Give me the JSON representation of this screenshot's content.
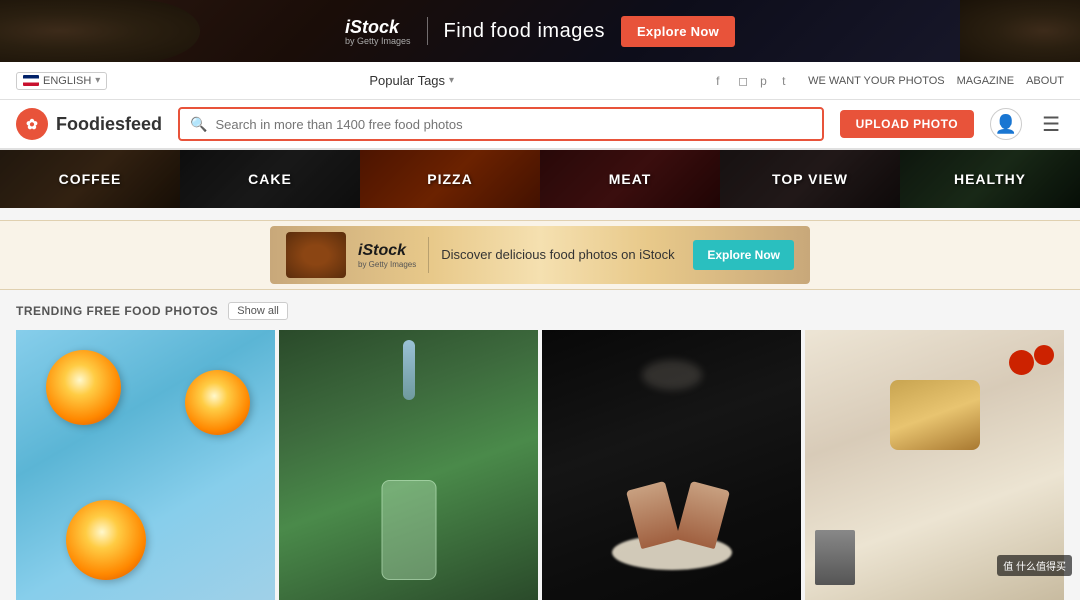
{
  "topBanner": {
    "istock": "iStock",
    "byGetty": "by Getty Images",
    "tagline": "Find food images",
    "ctaLabel": "Explore Now"
  },
  "navBar": {
    "language": "ENGLISH",
    "popularTags": "Popular Tags",
    "socialLinks": [
      "f",
      "ig",
      "p",
      "tw"
    ],
    "links": [
      "WE WANT YOUR PHOTOS",
      "MAGAZINE",
      "ABOUT"
    ]
  },
  "header": {
    "logoText": "Foodiesfeed",
    "searchPlaceholder": "Search in more than 1400 free food photos",
    "uploadLabel": "UPLOAD PHOTO"
  },
  "categories": [
    {
      "id": "coffee",
      "label": "COFFEE"
    },
    {
      "id": "cake",
      "label": "CAKE"
    },
    {
      "id": "pizza",
      "label": "PIZZA"
    },
    {
      "id": "meat",
      "label": "MEAT"
    },
    {
      "id": "topview",
      "label": "TOP VIEW"
    },
    {
      "id": "healthy",
      "label": "HEALTHY"
    }
  ],
  "istockBanner": {
    "logo": "iStock",
    "byGetty": "by Getty Images",
    "tagline": "Discover delicious food photos on iStock",
    "ctaLabel": "Explore Now"
  },
  "trending": {
    "title": "TRENDING FREE FOOD PHOTOS",
    "showAll": "Show all"
  },
  "photos": [
    {
      "id": "oranges",
      "alt": "Orange slices on blue background"
    },
    {
      "id": "drink",
      "alt": "Green drink being poured"
    },
    {
      "id": "baking",
      "alt": "Hands kneading dough in dark"
    },
    {
      "id": "spread",
      "alt": "Food spread on wooden board"
    }
  ],
  "watermark": "值 什么值得买"
}
